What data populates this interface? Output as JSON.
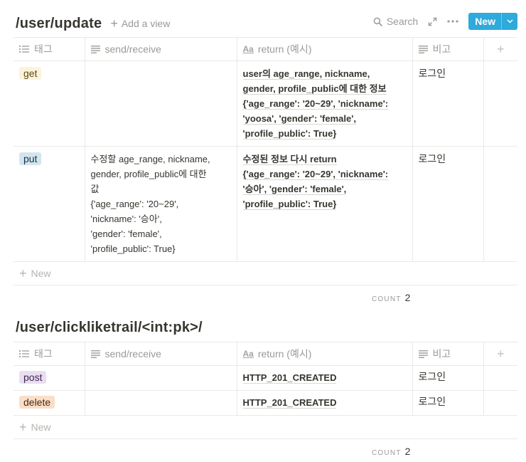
{
  "db1": {
    "title": "/user/update",
    "add_view_label": "Add a view",
    "search_label": "Search",
    "new_label": "New",
    "columns": [
      "태그",
      "send/receive",
      "return (예시)",
      "비고"
    ],
    "rows": [
      {
        "tag": "get",
        "tag_color": "#fbf3db",
        "send": [],
        "ret": [
          "user의 age_range, nickname,",
          "gender, profile_public에 대한 정보",
          "{'age_range': '20~29', 'nickname':",
          "'yoosa', 'gender': 'female',",
          "'profile_public': True}"
        ],
        "note": "로그인"
      },
      {
        "tag": "put",
        "tag_color": "#d3e5ef",
        "send": [
          "수정할 age_range, nickname,",
          "gender, profile_public에 대한",
          "값",
          "{'age_range': '20~29',",
          "'nickname': '승아',",
          "'gender': 'female',",
          "'profile_public': True}"
        ],
        "ret": [
          "수정된 정보 다시 return",
          "{'age_range': '20~29', 'nickname':",
          "'승아', 'gender': 'female',",
          "'profile_public': True}"
        ],
        "note": "로그인"
      }
    ],
    "new_row_label": "New",
    "count_label": "COUNT",
    "count_value": "2"
  },
  "db2": {
    "title": "/user/clickliketrail/<int:pk>/",
    "columns": [
      "태그",
      "send/receive",
      "return (예시)",
      "비고"
    ],
    "rows": [
      {
        "tag": "post",
        "tag_color": "#e8deee",
        "send": [],
        "ret": [
          "HTTP_201_CREATED"
        ],
        "note": "로그인"
      },
      {
        "tag": "delete",
        "tag_color": "#fadec9",
        "send": [],
        "ret": [
          "HTTP_201_CREATED"
        ],
        "note": "로그인"
      }
    ],
    "new_row_label": "New",
    "count_label": "COUNT",
    "count_value": "2"
  }
}
